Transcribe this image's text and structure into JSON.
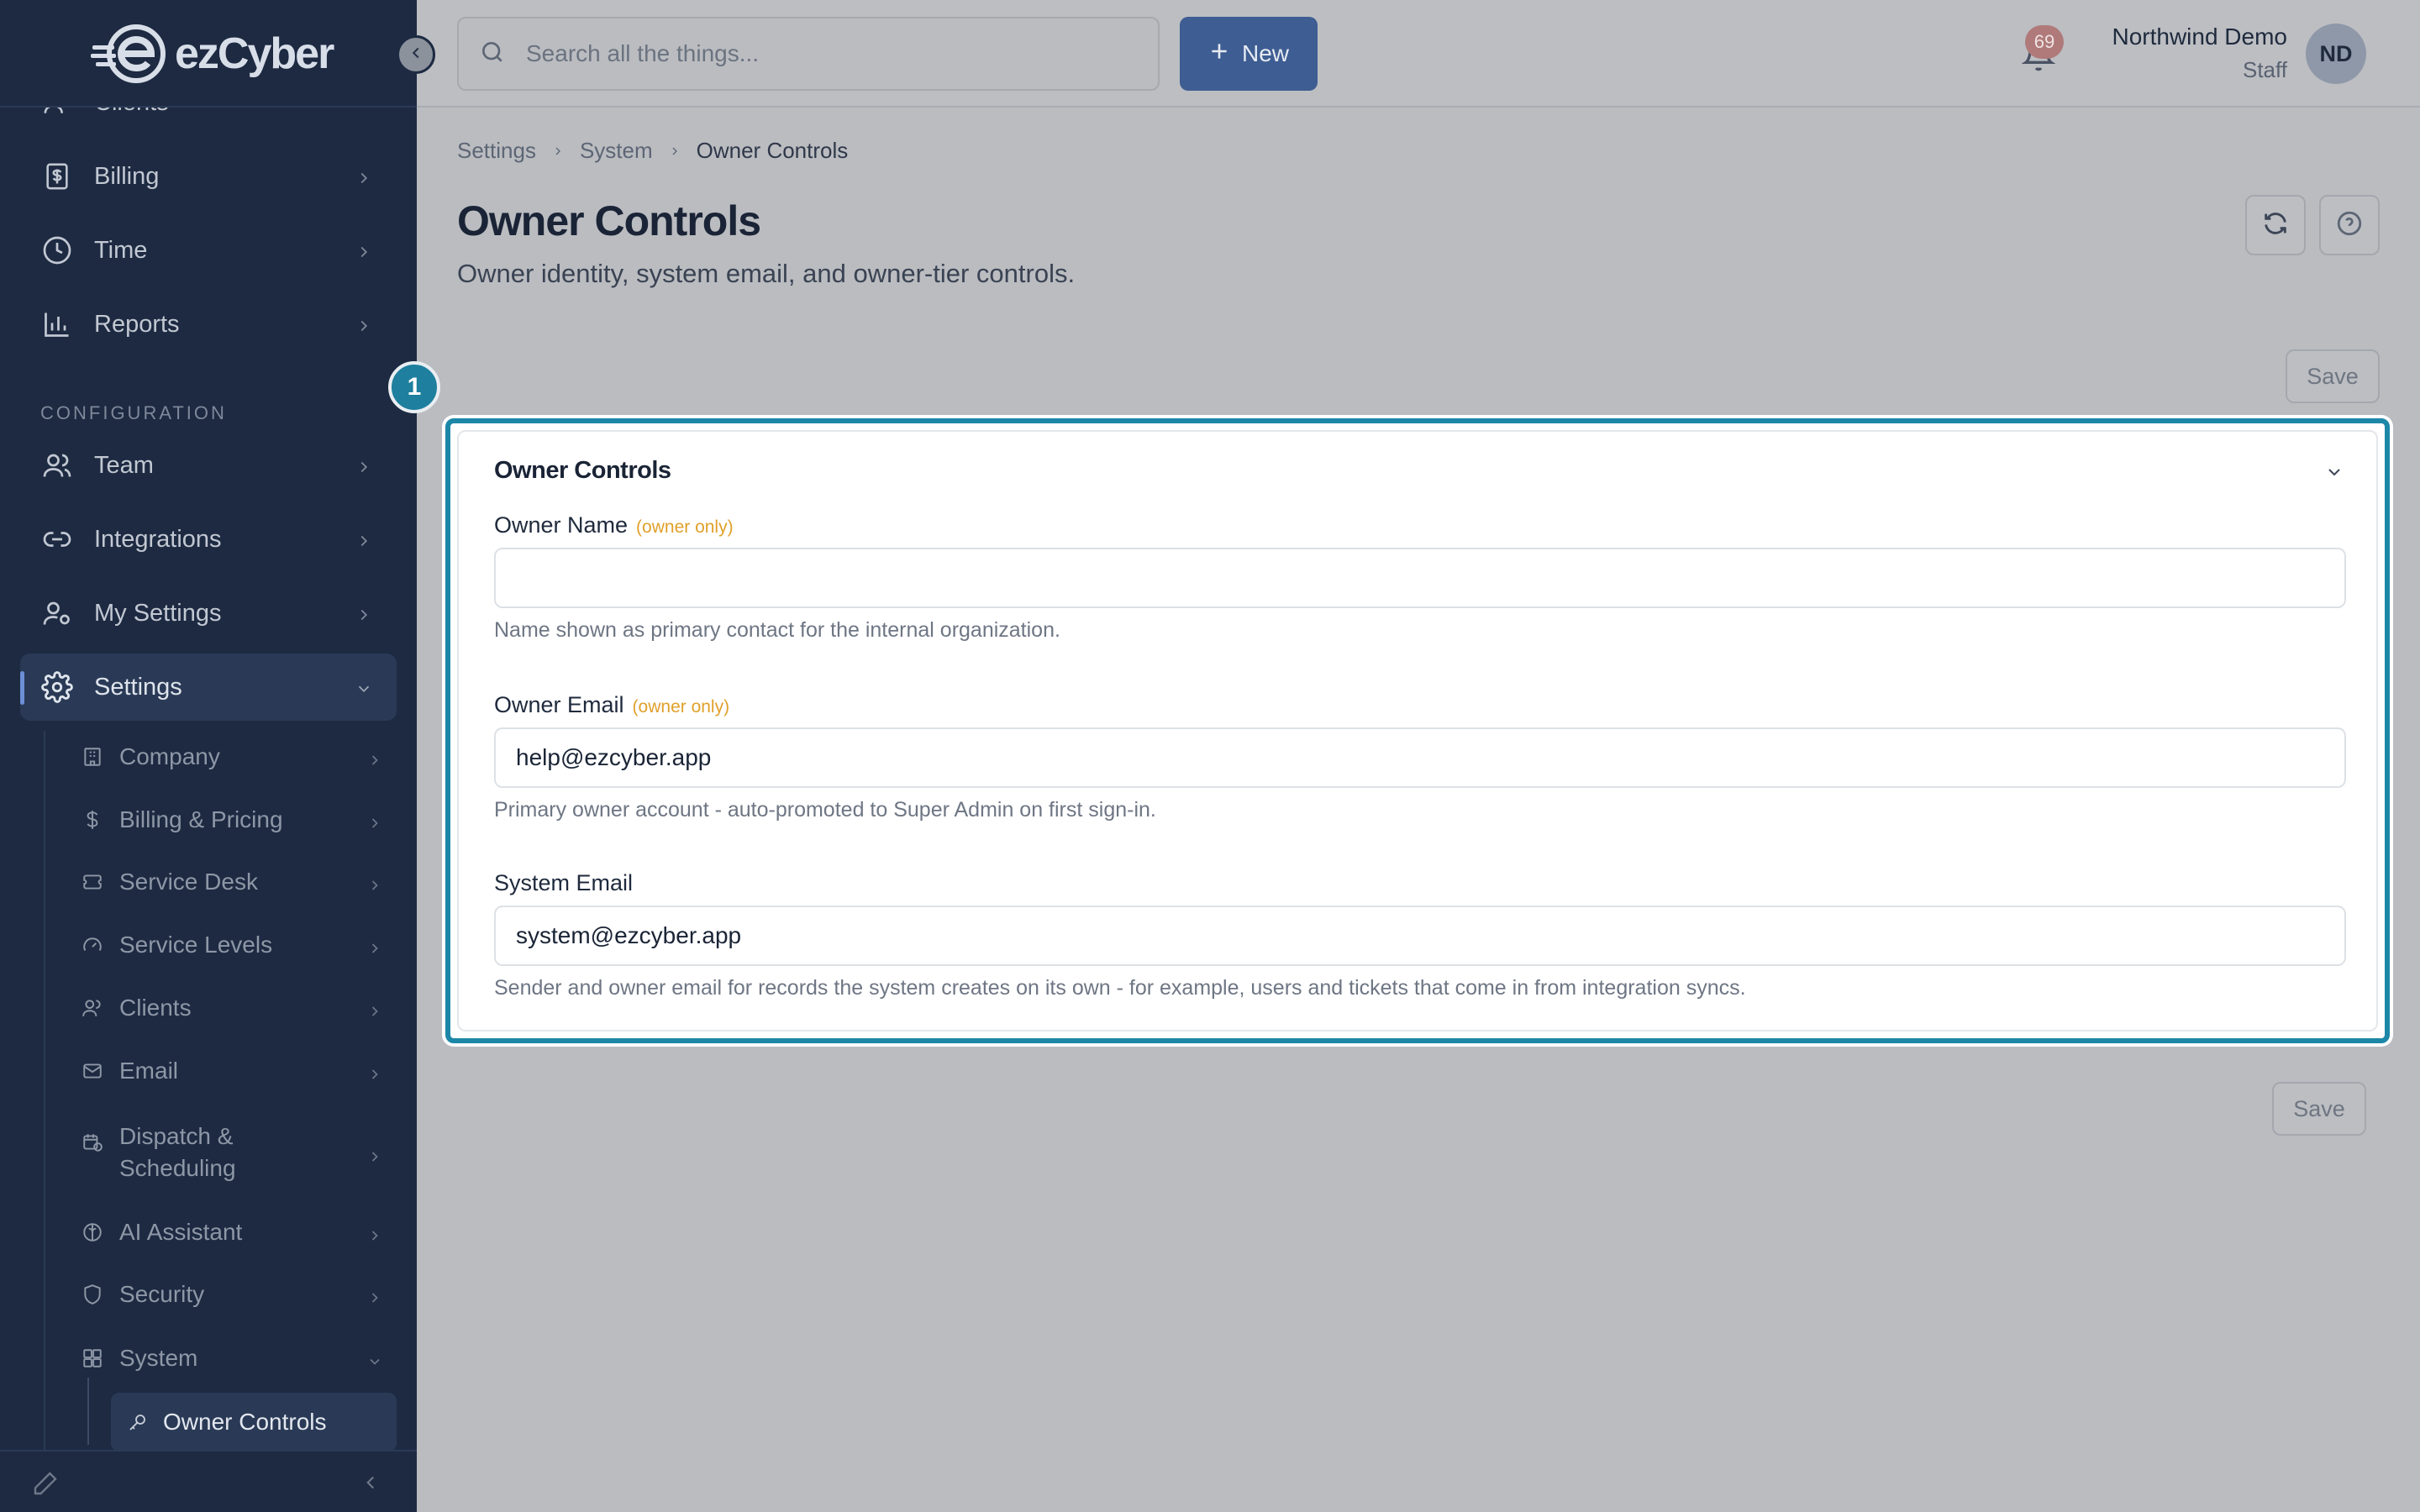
{
  "brand": {
    "name": "ezCyber"
  },
  "sidebar": {
    "partial_top_item": "Clients",
    "items": [
      {
        "label": "Billing",
        "icon": "billing-icon"
      },
      {
        "label": "Time",
        "icon": "clock-icon"
      },
      {
        "label": "Reports",
        "icon": "bar-chart-icon"
      }
    ],
    "section_label": "CONFIGURATION",
    "config_items": [
      {
        "label": "Team",
        "icon": "team-icon"
      },
      {
        "label": "Integrations",
        "icon": "link-icon"
      },
      {
        "label": "My Settings",
        "icon": "user-gear-icon"
      },
      {
        "label": "Settings",
        "icon": "gear-icon",
        "active": true
      }
    ],
    "settings_sub": [
      {
        "label": "Company"
      },
      {
        "label": "Billing & Pricing"
      },
      {
        "label": "Service Desk"
      },
      {
        "label": "Service Levels"
      },
      {
        "label": "Clients"
      },
      {
        "label": "Email"
      },
      {
        "label": "Dispatch &",
        "label2": "Scheduling"
      },
      {
        "label": "AI Assistant"
      },
      {
        "label": "Security"
      },
      {
        "label": "System",
        "expanded": true
      }
    ],
    "system_sub": [
      {
        "label": "Owner Controls",
        "active": true
      }
    ]
  },
  "topbar": {
    "search_placeholder": "Search all the things...",
    "new_label": "New",
    "notification_count": "69",
    "user_name": "Northwind Demo",
    "user_role": "Staff",
    "avatar_initials": "ND"
  },
  "breadcrumb": [
    "Settings",
    "System",
    "Owner Controls"
  ],
  "page": {
    "title": "Owner Controls",
    "subtitle": "Owner identity, system email, and owner-tier controls.",
    "save_label": "Save",
    "step_number": "1"
  },
  "card": {
    "title": "Owner Controls",
    "fields": [
      {
        "label": "Owner Name",
        "tag": "(owner only)",
        "value": "",
        "help": "Name shown as primary contact for the internal organization."
      },
      {
        "label": "Owner Email",
        "tag": "(owner only)",
        "value": "help@ezcyber.app",
        "help": "Primary owner account - auto-promoted to Super Admin on first sign-in."
      },
      {
        "label": "System Email",
        "tag": "",
        "value": "system@ezcyber.app",
        "help": "Sender and owner email for records the system creates on its own - for example, users and tickets that come in from integration syncs."
      }
    ]
  },
  "colors": {
    "sidebar_bg": "#1d2a42",
    "accent": "#1d87a8",
    "primary_button": "#3e5d92",
    "owner_only": "#e0a02a"
  }
}
